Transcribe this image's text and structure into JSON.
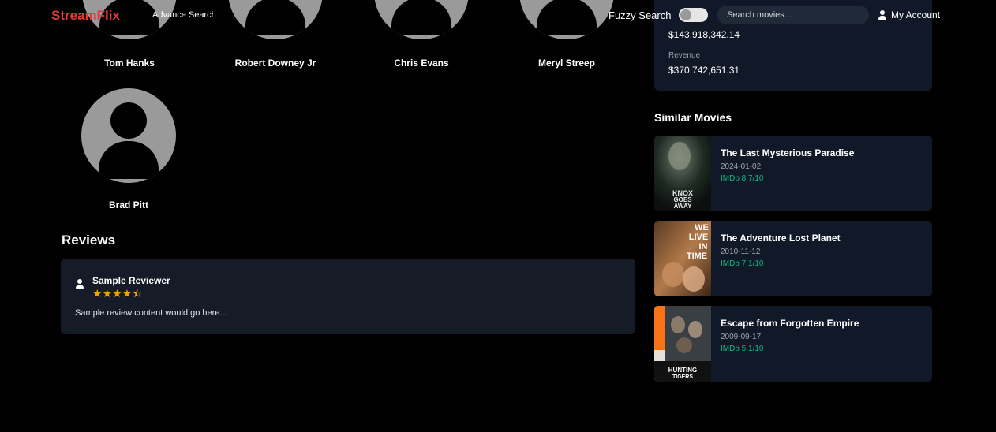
{
  "nav": {
    "logo": "StreamFlix",
    "advance_search": "Advance Search",
    "fuzzy_label": "Fuzzy Search",
    "fuzzy_enabled": false,
    "search_placeholder": "Search movies...",
    "account_label": "My Account"
  },
  "cast": [
    {
      "name": "Tom Hanks"
    },
    {
      "name": "Robert Downey Jr"
    },
    {
      "name": "Chris Evans"
    },
    {
      "name": "Meryl Streep"
    },
    {
      "name": "Brad Pitt"
    }
  ],
  "financials": {
    "budget_value": "$143,918,342.14",
    "revenue_label": "Revenue",
    "revenue_value": "$370,742,651.31"
  },
  "reviews": {
    "title": "Reviews",
    "items": [
      {
        "reviewer": "Sample Reviewer",
        "stars": "★★★★⯪",
        "rating": 4.5,
        "content": "Sample review content would go here..."
      }
    ]
  },
  "similar": {
    "title": "Similar Movies",
    "items": [
      {
        "title": "The Last Mysterious Paradise",
        "date": "2024-01-02",
        "rating": "IMDb 8.7/10",
        "poster_text": "KNOX GOES AWAY"
      },
      {
        "title": "The Adventure Lost Planet",
        "date": "2010-11-12",
        "rating": "IMDb 7.1/10",
        "poster_text": "WE LIVE IN TIME"
      },
      {
        "title": "Escape from Forgotten Empire",
        "date": "2009-09-17",
        "rating": "IMDb 5.1/10",
        "poster_text": "HUNTING TIGERS"
      }
    ]
  },
  "colors": {
    "brand": "#e53935",
    "card_bg": "#111827",
    "rating_green": "#10b981",
    "star": "#f59e0b"
  }
}
